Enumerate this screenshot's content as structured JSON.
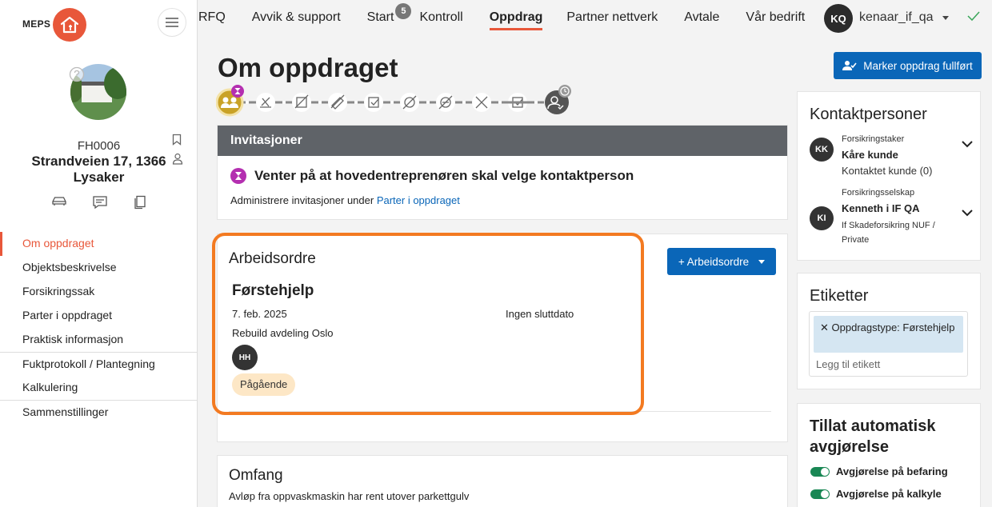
{
  "brand": {
    "name": "MEPS",
    "accent": "#e8573a",
    "primary": "#0a66b8"
  },
  "topnav": {
    "items": [
      {
        "label": "RFQ",
        "active": false
      },
      {
        "label": "Avvik & support",
        "active": false
      },
      {
        "label": "Start",
        "badge": "5",
        "active": false
      },
      {
        "label": "Kontroll",
        "active": false
      },
      {
        "label": "Oppdrag",
        "active": true
      },
      {
        "label": "Partner nettverk",
        "active": false
      },
      {
        "label": "Avtale",
        "active": false
      },
      {
        "label": "Vår bedrift",
        "active": false
      }
    ],
    "user": {
      "initials": "KQ",
      "name": "kenaar_if_qa"
    }
  },
  "property": {
    "id": "FH0006",
    "address": "Strandveien 17, 1366 Lysaker"
  },
  "sidebar": {
    "items": [
      {
        "label": "Om oppdraget",
        "active": true
      },
      {
        "label": "Objektsbeskrivelse"
      },
      {
        "label": "Forsikringssak"
      },
      {
        "label": "Parter i oppdraget"
      },
      {
        "label": "Praktisk informasjon"
      },
      {
        "label": "Fuktprotokoll / Plantegning"
      },
      {
        "label": "Kalkulering"
      },
      {
        "label": "Sammenstillinger"
      }
    ]
  },
  "main": {
    "title": "Om oppdraget",
    "mark_complete_label": "Marker oppdrag fullført",
    "invitations": {
      "header": "Invitasjoner",
      "status": "Venter på at hovedentreprenøren skal velge kontaktperson",
      "text_prefix": "Administrere invitasjoner under ",
      "link": "Parter i oppdraget"
    },
    "workorders": {
      "title": "Arbeidsordre",
      "add_label": "+ Arbeidsordre",
      "item": {
        "name": "Førstehjelp",
        "start": "7. feb. 2025",
        "end": "Ingen sluttdato",
        "department": "Rebuild avdeling Oslo",
        "assignee": "HH",
        "status": "Pågående"
      }
    },
    "scope": {
      "title": "Omfang",
      "text": "Avløp fra oppvaskmaskin har rent utover parkettgulv"
    }
  },
  "contacts": {
    "title": "Kontaktpersoner",
    "items": [
      {
        "initials": "KK",
        "role": "Forsikringstaker",
        "name": "Kåre kunde",
        "sub": "Kontaktet kunde (0)"
      },
      {
        "initials": "KI",
        "role": "Forsikringsselskap",
        "name": "Kenneth i IF QA",
        "sub": "If Skadeforsikring NUF / Private"
      }
    ]
  },
  "labels": {
    "title": "Etiketter",
    "tag": "Oppdragstype: Førstehjelp",
    "add_placeholder": "Legg til etikett"
  },
  "auto_decision": {
    "title": "Tillat automatisk avgjørelse",
    "toggles": [
      {
        "label": "Avgjørelse på befaring",
        "on": true
      },
      {
        "label": "Avgjørelse på kalkyle",
        "on": true
      }
    ]
  }
}
